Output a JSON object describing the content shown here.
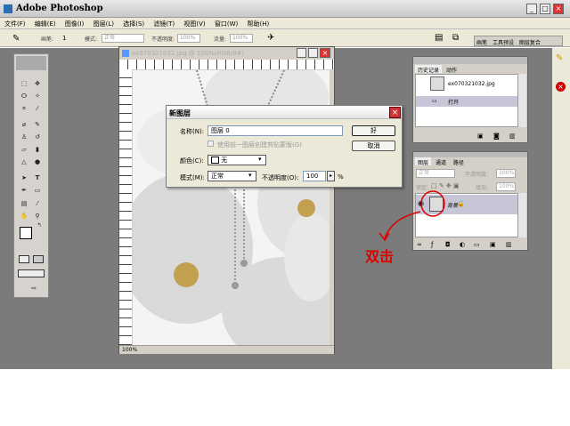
{
  "app": {
    "title": "Adobe Photoshop",
    "window_buttons": [
      "_",
      "□",
      "×"
    ]
  },
  "menu": [
    "文件(F)",
    "编辑(E)",
    "图像(I)",
    "图层(L)",
    "选择(S)",
    "滤镜(T)",
    "视图(V)",
    "窗口(W)",
    "帮助(H)"
  ],
  "options": {
    "size_label": "画笔:",
    "size_value": "1",
    "mode_label": "模式:",
    "mode_value": "正常",
    "opacity_label": "不透明度:",
    "opacity_value": "100%",
    "flow_label": "流量:",
    "flow_value": "100%",
    "tabs": [
      "画笔",
      "工具预设",
      "图层复合"
    ]
  },
  "document": {
    "title": "ex070321032.jpg @ 100%(RGB/8#)",
    "zoom": "100%"
  },
  "dialog": {
    "title": "新图层",
    "name_label": "名称(N):",
    "name_value": "图层 0",
    "group_label": "使用前一图层创建剪贴蒙版(G)",
    "color_label": "颜色(C):",
    "color_value": "无",
    "mode_label": "模式(M):",
    "mode_value": "正常",
    "opacity_label": "不透明度(O):",
    "opacity_value": "100",
    "percent": "%",
    "ok": "好",
    "cancel": "取消"
  },
  "history": {
    "tabs": [
      "历史记录",
      "动作"
    ],
    "snapshot": "ex070321032.jpg",
    "step": "打开"
  },
  "layers": {
    "tabs": [
      "图层",
      "通道",
      "路径"
    ],
    "mode_value": "正常",
    "opacity_label": "不透明度:",
    "opacity_value": "100%",
    "lock_label": "锁定:",
    "fill_label": "填充:",
    "fill_value": "100%",
    "layer_name": "背景"
  },
  "annotation": "双击"
}
